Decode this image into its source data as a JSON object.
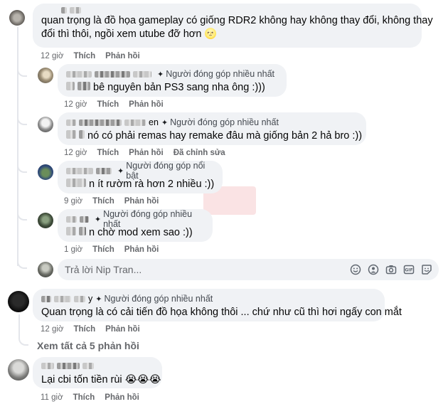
{
  "top": {
    "text_line1": "quan trọng là đồ họa gameplay có giống RDR2 không hay không thay đổi, không thay",
    "text_line2": "đổi thì thôi, ngồi xem utube đỡ hơn",
    "emoji": "🌝",
    "time": "12 giờ",
    "like": "Thích",
    "reply": "Phản hồi"
  },
  "replies": [
    {
      "badge": "Người đóng góp nhiều nhất",
      "text": "bê nguyên bản PS3 sang nha ông :)))",
      "time": "12 giờ",
      "like": "Thích",
      "reply": "Phản hồi"
    },
    {
      "name_suffix": "en",
      "badge": "Người đóng góp nhiều nhất",
      "text": "nó có phải remas hay remake đâu mà giống bản 2 hả bro :))",
      "time": "12 giờ",
      "like": "Thích",
      "reply": "Phản hồi",
      "edited": "Đã chỉnh sửa"
    },
    {
      "badge": "Người đóng góp nổi bật",
      "text_prefix": "n",
      "text": "ít rườm rà hơn 2 nhiều :))",
      "time": "9 giờ",
      "like": "Thích",
      "reply": "Phản hồi"
    },
    {
      "badge": "Người đóng góp nhiều nhất",
      "text_prefix": "n",
      "text": "chờ mod xem sao :))",
      "time": "1 giờ",
      "like": "Thích",
      "reply": "Phản hồi"
    }
  ],
  "reply_box": {
    "placeholder": "Trả lời Nip Tran..."
  },
  "comment2": {
    "name_suffix": "y",
    "badge": "Người đóng góp nhiều nhất",
    "text": "Quan trọng là có cải tiến đồ họa không thôi ... chứ như cũ thì hơi ngấy con mắt",
    "time": "12 giờ",
    "like": "Thích",
    "reply": "Phản hồi"
  },
  "see_all": "Xem tất cả 5 phản hồi",
  "comment3": {
    "text": "Lại cbi tốn tiền rùi",
    "emoji": "😭😭😭",
    "time": "11 giờ",
    "like": "Thích",
    "reply": "Phản hồi"
  },
  "icons": {
    "badge": "contributor-badge-icon",
    "reply_box": [
      "emoji-icon",
      "avatar-sticker-icon",
      "camera-icon",
      "gif-icon",
      "sticker-icon"
    ]
  },
  "colors": {
    "bubble": "#f0f2f5",
    "meta": "#65676b",
    "text": "#050505"
  }
}
